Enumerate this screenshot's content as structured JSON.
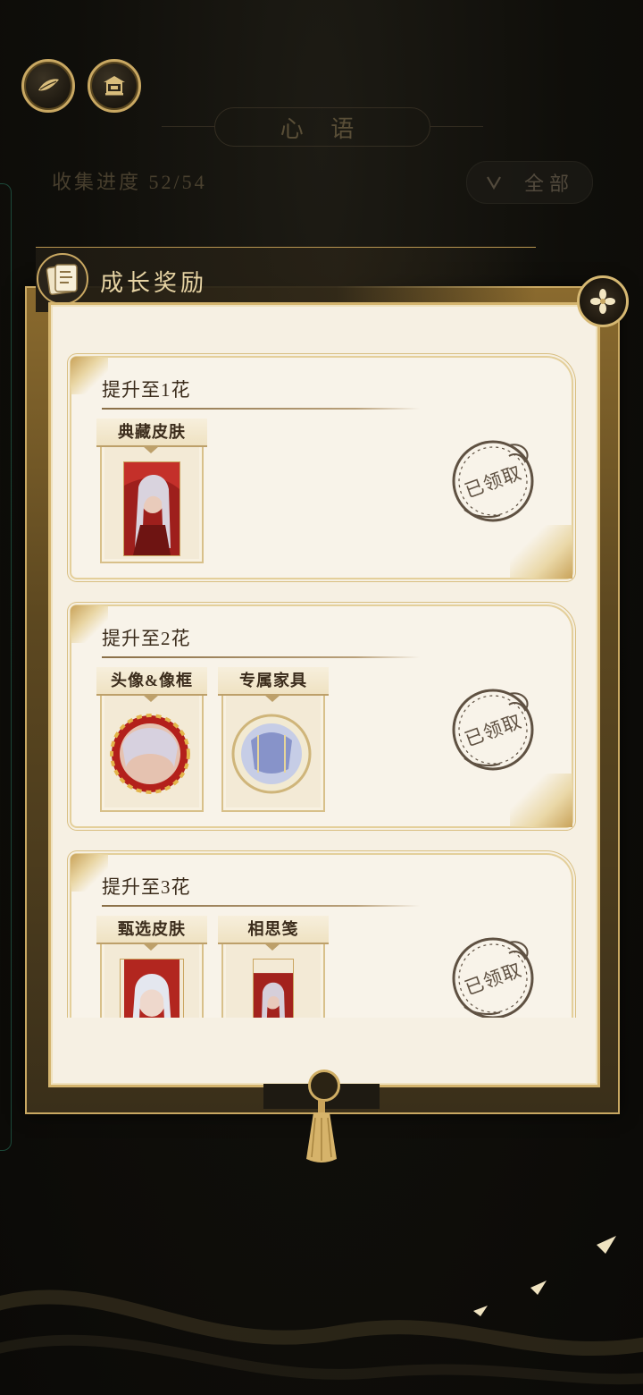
{
  "header": {
    "title": "心 语",
    "progress_label": "收集进度 52/54",
    "filter_label": "全部"
  },
  "dialog": {
    "title": "成长奖励",
    "rewards": [
      {
        "title": "提升至1花",
        "status": "已领取",
        "items": [
          {
            "label": "典藏皮肤"
          }
        ]
      },
      {
        "title": "提升至2花",
        "status": "已领取",
        "items": [
          {
            "label": "头像&像框"
          },
          {
            "label": "专属家具"
          }
        ]
      },
      {
        "title": "提升至3花",
        "status": "已领取",
        "items": [
          {
            "label": "甄选皮肤"
          },
          {
            "label": "相思笺"
          }
        ]
      }
    ]
  },
  "colors": {
    "gold": "#c9a862",
    "paper": "#f6f0e3",
    "stamp": "#5f5142",
    "background": "#0f0e0a"
  }
}
